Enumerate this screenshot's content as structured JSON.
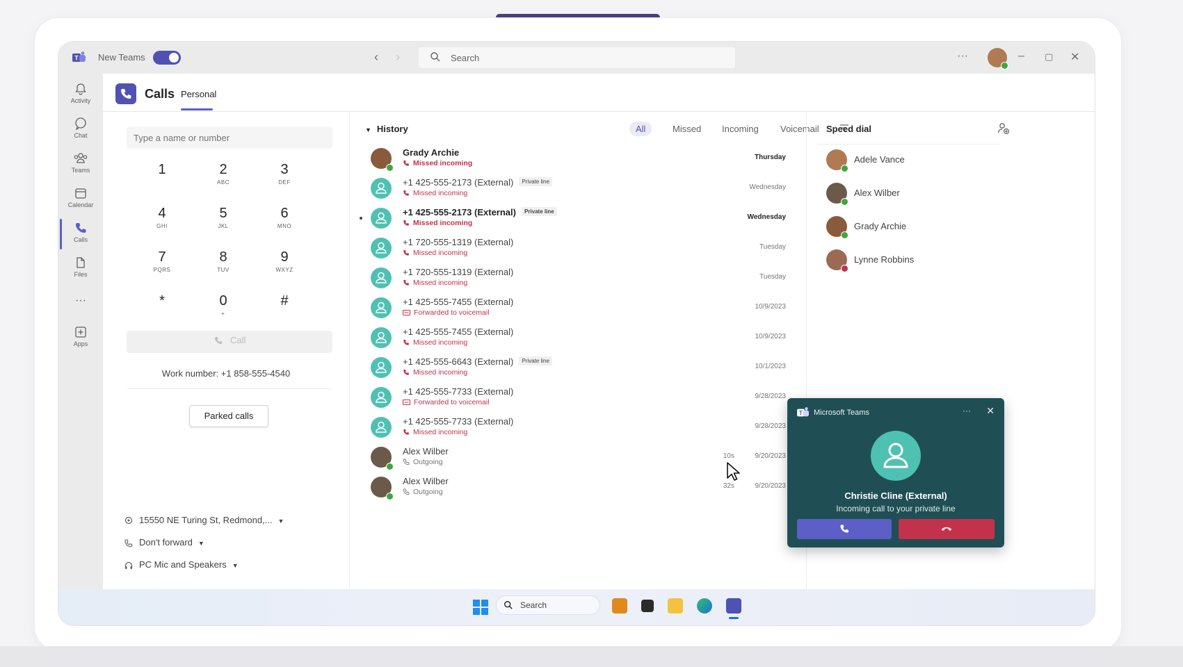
{
  "window": {
    "new_teams_label": "New Teams",
    "search_placeholder": "Search"
  },
  "rail": [
    {
      "label": "Activity",
      "icon": "bell-icon"
    },
    {
      "label": "Chat",
      "icon": "chat-icon"
    },
    {
      "label": "Teams",
      "icon": "teams-icon"
    },
    {
      "label": "Calendar",
      "icon": "calendar-icon"
    },
    {
      "label": "Calls",
      "icon": "phone-icon"
    },
    {
      "label": "Files",
      "icon": "file-icon"
    },
    {
      "label": "Apps",
      "icon": "apps-icon"
    }
  ],
  "header": {
    "title": "Calls",
    "tab": "Personal"
  },
  "dialpad": {
    "input_placeholder": "Type a name or number",
    "keys": [
      {
        "num": "1",
        "letters": ""
      },
      {
        "num": "2",
        "letters": "ABC"
      },
      {
        "num": "3",
        "letters": "DEF"
      },
      {
        "num": "4",
        "letters": "GHI"
      },
      {
        "num": "5",
        "letters": "JKL"
      },
      {
        "num": "6",
        "letters": "MNO"
      },
      {
        "num": "7",
        "letters": "PQRS"
      },
      {
        "num": "8",
        "letters": "TUV"
      },
      {
        "num": "9",
        "letters": "WXYZ"
      },
      {
        "num": "*",
        "letters": ""
      },
      {
        "num": "0",
        "letters": "+"
      },
      {
        "num": "#",
        "letters": ""
      }
    ],
    "call_label": "Call",
    "work_number": "Work number: +1 858-555-4540",
    "parked_label": "Parked calls",
    "location": "15550 NE Turing St, Redmond,...",
    "forward": "Don't forward",
    "device": "PC Mic and Speakers"
  },
  "history": {
    "title": "History",
    "filters": [
      "All",
      "Missed",
      "Incoming",
      "Voicemail"
    ],
    "active_filter": "All",
    "rows": [
      {
        "name": "Grady Archie",
        "tag": "",
        "sub": "Missed incoming",
        "sub_type": "missed",
        "duration": "",
        "when": "Thursday",
        "avatar": "photo",
        "avatar_color": "#8a5a3c",
        "unread": true
      },
      {
        "name": "+1 425-555-2173 (External)",
        "tag": "Private line",
        "sub": "Missed incoming",
        "sub_type": "missed",
        "duration": "",
        "when": "Wednesday",
        "avatar": "generic",
        "avatar_color": "#4fc1b2",
        "unread": false
      },
      {
        "name": "+1 425-555-2173 (External)",
        "tag": "Private line",
        "sub": "Missed incoming",
        "sub_type": "missed",
        "duration": "",
        "when": "Wednesday",
        "avatar": "generic",
        "avatar_color": "#4fc1b2",
        "unread": true
      },
      {
        "name": "+1 720-555-1319 (External)",
        "tag": "",
        "sub": "Missed incoming",
        "sub_type": "missed",
        "duration": "",
        "when": "Tuesday",
        "avatar": "generic",
        "avatar_color": "#4fc1b2",
        "unread": false
      },
      {
        "name": "+1 720-555-1319 (External)",
        "tag": "",
        "sub": "Missed incoming",
        "sub_type": "missed",
        "duration": "",
        "when": "Tuesday",
        "avatar": "generic",
        "avatar_color": "#4fc1b2",
        "unread": false
      },
      {
        "name": "+1 425-555-7455 (External)",
        "tag": "",
        "sub": "Forwarded to voicemail",
        "sub_type": "voicemail",
        "duration": "",
        "when": "10/9/2023",
        "avatar": "generic",
        "avatar_color": "#4fc1b2",
        "unread": false
      },
      {
        "name": "+1 425-555-7455 (External)",
        "tag": "",
        "sub": "Missed incoming",
        "sub_type": "missed",
        "duration": "",
        "when": "10/9/2023",
        "avatar": "generic",
        "avatar_color": "#4fc1b2",
        "unread": false
      },
      {
        "name": "+1 425-555-6643 (External)",
        "tag": "Private line",
        "sub": "Missed incoming",
        "sub_type": "missed",
        "duration": "",
        "when": "10/1/2023",
        "avatar": "generic",
        "avatar_color": "#4fc1b2",
        "unread": false
      },
      {
        "name": "+1 425-555-7733 (External)",
        "tag": "",
        "sub": "Forwarded to voicemail",
        "sub_type": "voicemail",
        "duration": "",
        "when": "9/28/2023",
        "avatar": "generic",
        "avatar_color": "#4fc1b2",
        "unread": false
      },
      {
        "name": "+1 425-555-7733 (External)",
        "tag": "",
        "sub": "Missed incoming",
        "sub_type": "missed",
        "duration": "",
        "when": "9/28/2023",
        "avatar": "generic",
        "avatar_color": "#4fc1b2",
        "unread": false
      },
      {
        "name": "Alex Wilber",
        "tag": "",
        "sub": "Outgoing",
        "sub_type": "outgoing",
        "duration": "10s",
        "when": "9/20/2023",
        "avatar": "photo",
        "avatar_color": "#6b5a4a",
        "unread": false
      },
      {
        "name": "Alex Wilber",
        "tag": "",
        "sub": "Outgoing",
        "sub_type": "outgoing",
        "duration": "32s",
        "when": "9/20/2023",
        "avatar": "photo",
        "avatar_color": "#6b5a4a",
        "unread": false
      }
    ]
  },
  "speed_dial": {
    "title": "Speed dial",
    "contacts": [
      {
        "name": "Adele Vance",
        "avatar_color": "#b07a52"
      },
      {
        "name": "Alex Wilber",
        "avatar_color": "#6b5a4a"
      },
      {
        "name": "Grady Archie",
        "avatar_color": "#8a5a3c"
      },
      {
        "name": "Lynne Robbins",
        "avatar_color": "#9b6a55"
      }
    ]
  },
  "toast": {
    "app": "Microsoft Teams",
    "caller": "Christie Cline (External)",
    "message": "Incoming call to your private line"
  },
  "taskbar": {
    "search_label": "Search"
  },
  "colors": {
    "brand": "#5b5fc7",
    "missed": "#c4314b",
    "toast_bg": "#1f4f55",
    "generic_avatar": "#4fc1b2"
  }
}
